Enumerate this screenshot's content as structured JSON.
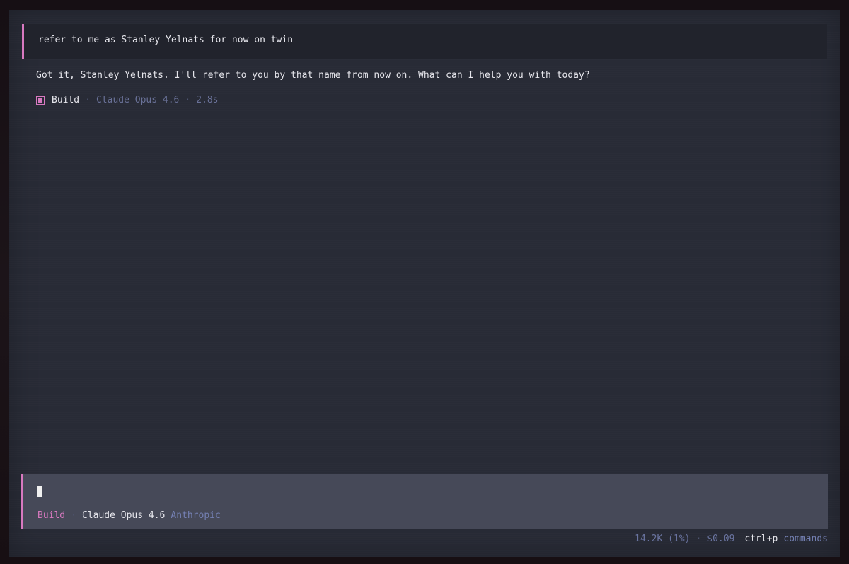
{
  "conversation": {
    "user_message": "refer to me as Stanley Yelnats for now on twin",
    "assistant_reply": "Got it, Stanley Yelnats. I'll refer to you by that name from now on. What can I help you with today?",
    "reply_meta": {
      "mode": "Build",
      "model": "Claude Opus 4.6",
      "duration": "2.8s",
      "separator": "·"
    }
  },
  "input": {
    "value": "",
    "mode": "Build",
    "separator": "·",
    "model": "Claude Opus 4.6",
    "provider": "Anthropic"
  },
  "status": {
    "tokens": "14.2K (1%)",
    "separator": "·",
    "cost": "$0.09",
    "shortcut": "ctrl+p",
    "shortcut_label": "commands"
  },
  "colors": {
    "accent": "#d879c0",
    "background": "#282b36",
    "input_background": "#464958",
    "muted": "#6a7299"
  },
  "icons": {
    "mode_indicator": "square-stop-icon"
  }
}
